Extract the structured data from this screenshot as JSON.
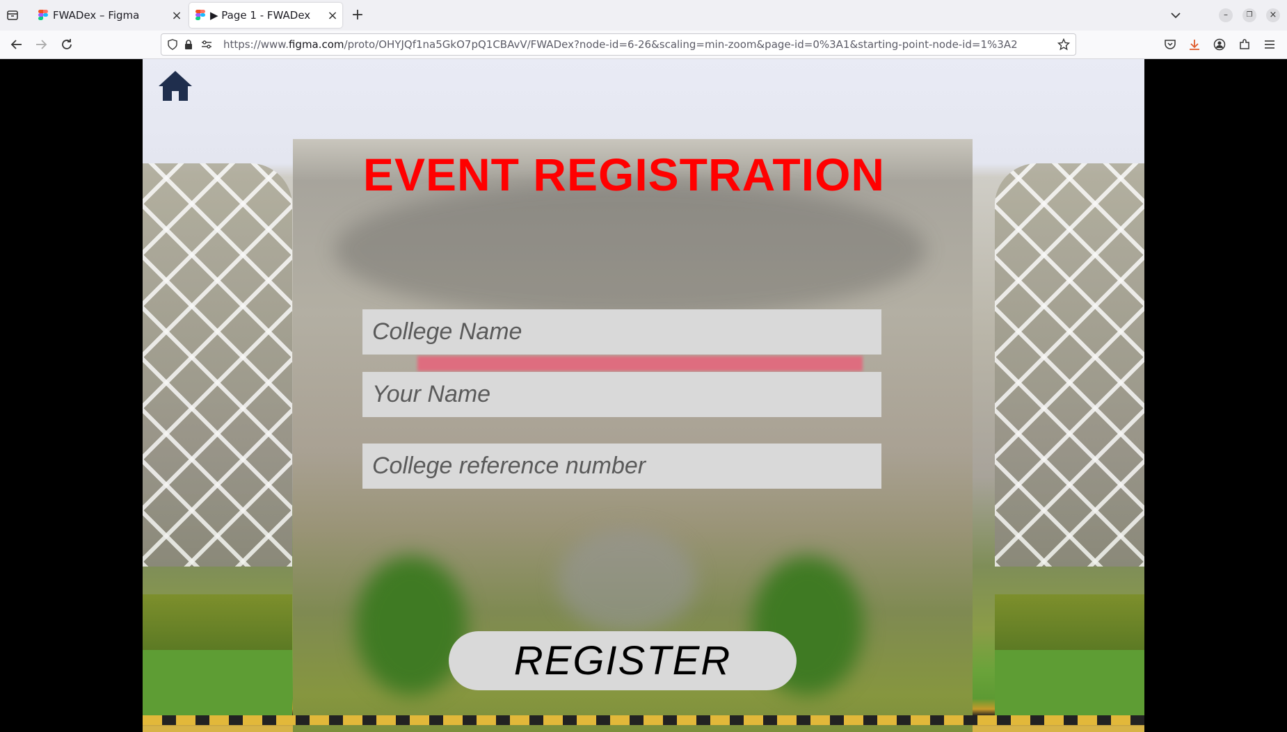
{
  "browser": {
    "tabs": [
      {
        "label": "FWADex – Figma",
        "active": false
      },
      {
        "label": "▶ Page 1 - FWADex",
        "active": true
      }
    ],
    "new_tab_icon": "plus-icon",
    "url_prefix": "https://www.",
    "url_domain": "figma.com",
    "url_rest": "/proto/OHYJQf1na5GkO7pQ1CBAvV/FWADex?node-id=6-26&scaling=min-zoom&page-id=0%3A1&starting-point-node-id=1%3A2"
  },
  "page": {
    "heading": "EVENT REGISTRATION",
    "fields": {
      "college_name": "College Name",
      "your_name": "Your Name",
      "reference": "College reference number"
    },
    "register_label": "REGISTER"
  },
  "colors": {
    "heading": "#ff0000",
    "home_icon": "#1f2e4d",
    "field_bg": "#d9d9d9"
  }
}
